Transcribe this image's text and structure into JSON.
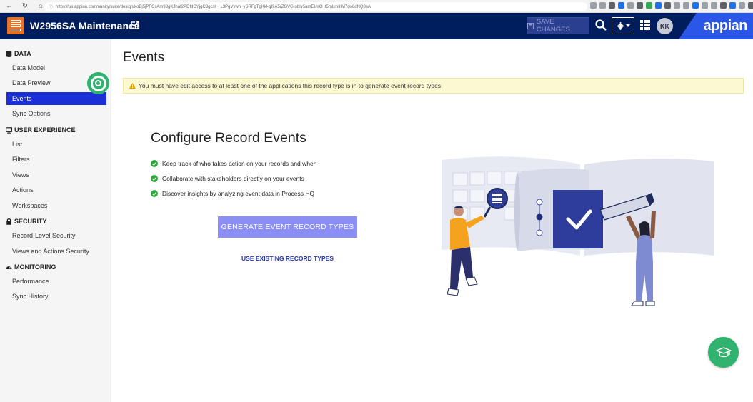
{
  "browser": {
    "url": "https://us.appian.community/suite/design/koBj5jPFCsAm98gKJhaf2PDfdCYjgC3gcsl__L3PgVxwn_ySRFgTgKkl-gI9A5rZGVGIobIv5amEUsO_t5mLmIIiM7do6dNQ8sA"
  },
  "header": {
    "app_title": "W2956SA Maintenance",
    "save_label": "SAVE CHANGES",
    "avatar_initials": "KK",
    "brand": "appian",
    "colors": {
      "header_bg": "#001d5e",
      "logo_bg": "#e4722a",
      "brand_bg": "#2a57e8"
    }
  },
  "sidebar": {
    "sections": [
      {
        "title": "DATA",
        "icon": "database-icon",
        "items": [
          "Data Model",
          "Data Preview",
          "Events",
          "Sync Options"
        ]
      },
      {
        "title": "USER EXPERIENCE",
        "icon": "monitor-icon",
        "items": [
          "List",
          "Filters",
          "Views",
          "Actions",
          "Workspaces"
        ]
      },
      {
        "title": "SECURITY",
        "icon": "lock-icon",
        "items": [
          "Record-Level Security",
          "Views and Actions Security"
        ]
      },
      {
        "title": "MONITORING",
        "icon": "gauge-icon",
        "items": [
          "Performance",
          "Sync History"
        ]
      }
    ],
    "active_item": "Events",
    "active_color": "#1a2fd6"
  },
  "main": {
    "page_title": "Events",
    "warning": "You must have edit access to at least one of the applications this record type is in to generate event record types",
    "config_title": "Configure Record Events",
    "features": [
      "Keep track of who takes action on your records and when",
      "Collaborate with stakeholders directly on your events",
      "Discover insights by analyzing event data in Process HQ"
    ],
    "generate_label": "GENERATE EVENT RECORD TYPES",
    "use_existing_label": "USE EXISTING RECORD TYPES",
    "generate_color": "#8b8ef5"
  }
}
